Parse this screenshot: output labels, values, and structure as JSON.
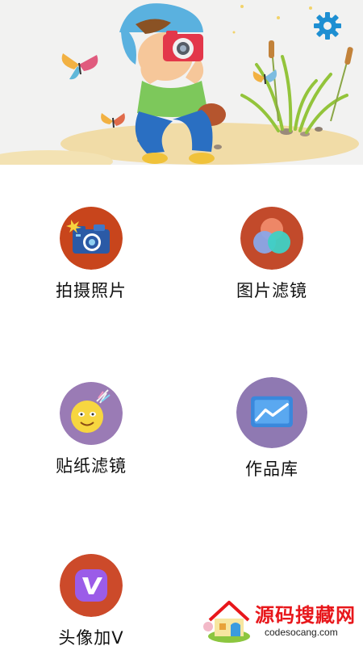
{
  "header": {
    "illustration": "boy-with-camera-illustration",
    "settings_icon": "gear-icon",
    "accent_color": "#1e8fd2"
  },
  "menu": {
    "items": [
      {
        "label": "拍摄照片",
        "icon": "camera-icon",
        "circle_color": "#c8451c"
      },
      {
        "label": "图片滤镜",
        "icon": "color-filter-icon",
        "circle_color": "#c24a2b"
      },
      {
        "label": "贴纸滤镜",
        "icon": "smiley-sticker-icon",
        "circle_color": "#9a7bb5"
      },
      {
        "label": "作品库",
        "icon": "gallery-chart-icon",
        "circle_color": "#8f79b2"
      },
      {
        "label": "头像加V",
        "icon": "v-badge-icon",
        "circle_color": "#cc4a2a"
      }
    ]
  },
  "watermark": {
    "title": "源码搜藏网",
    "url": "codesocang.com",
    "logo_icon": "house-icon"
  }
}
